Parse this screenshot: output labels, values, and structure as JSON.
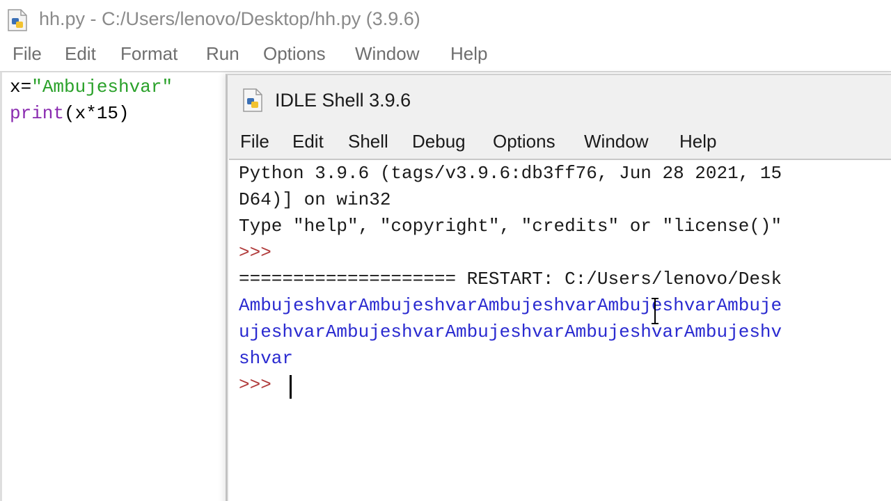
{
  "editor": {
    "title": "hh.py - C:/Users/lenovo/Desktop/hh.py (3.9.6)",
    "menu": [
      "File",
      "Edit",
      "Format",
      "Run",
      "Options",
      "Window",
      "Help"
    ],
    "code": {
      "line1_var": "x=",
      "line1_str": "\"Ambujeshvar\"",
      "line2_builtin": "print",
      "line2_rest": "(x*15)"
    }
  },
  "shell": {
    "title": "IDLE Shell 3.9.6",
    "menu": [
      "File",
      "Edit",
      "Shell",
      "Debug",
      "Options",
      "Window",
      "Help"
    ],
    "lines": {
      "banner1": "Python 3.9.6 (tags/v3.9.6:db3ff76, Jun 28 2021, 15",
      "banner2": "D64)] on win32",
      "banner3": "Type \"help\", \"copyright\", \"credits\" or \"license()\"",
      "prompt1": ">>>",
      "restart": "==================== RESTART: C:/Users/lenovo/Desk",
      "output1": "AmbujeshvarAmbujeshvarAmbujeshvarAmbujeshvarAmbuje",
      "output2": "ujeshvarAmbujeshvarAmbujeshvarAmbujeshvarAmbujeshv",
      "output3": "shvar",
      "prompt2": ">>>"
    }
  },
  "colors": {
    "string": "#2aa12a",
    "builtin": "#8a2bb0",
    "prompt": "#b03a3a",
    "output": "#2a2ad0"
  },
  "icons": {
    "editor_title": "python-file-icon",
    "shell_title": "python-file-icon"
  }
}
